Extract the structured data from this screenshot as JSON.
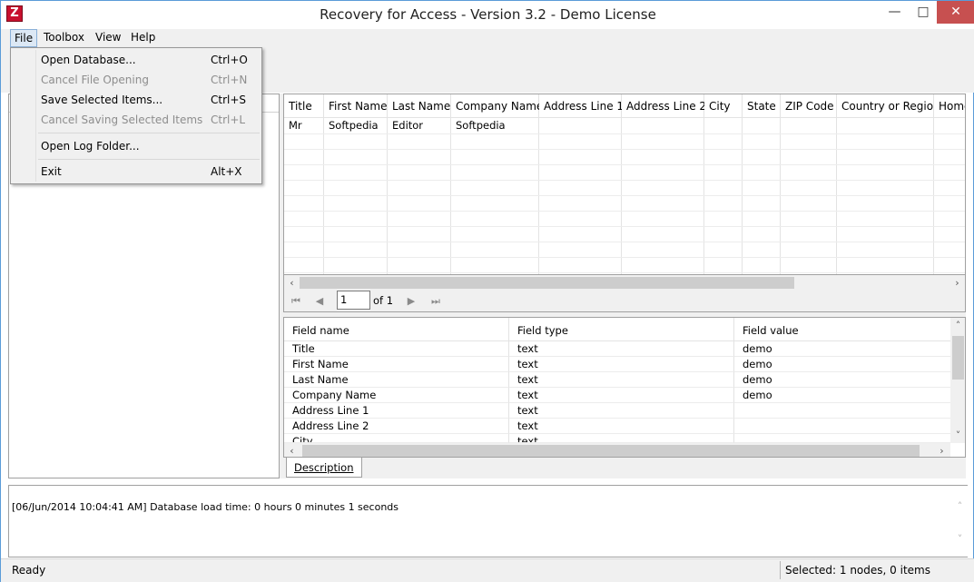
{
  "window": {
    "title": "Recovery for Access - Version 3.2 - Demo License",
    "app_icon": "Z",
    "minimize_icon": "minimize-icon",
    "maximize_icon": "maximize-icon",
    "close_icon": "close-icon",
    "min_glyph": "—",
    "max_glyph": "□",
    "close_glyph": "✕"
  },
  "menubar": {
    "file": "File",
    "toolbox": "Toolbox",
    "view": "View",
    "help": "Help"
  },
  "file_menu": {
    "items": [
      {
        "label": "Open Database...",
        "shortcut": "Ctrl+O",
        "enabled": true
      },
      {
        "label": "Cancel File Opening",
        "shortcut": "Ctrl+N",
        "enabled": false
      },
      {
        "label": "Save Selected Items...",
        "shortcut": "Ctrl+S",
        "enabled": true
      },
      {
        "label": "Cancel Saving Selected Items",
        "shortcut": "Ctrl+L",
        "enabled": false
      },
      {
        "label": "Open Log Folder...",
        "shortcut": "",
        "enabled": true
      },
      {
        "label": "Exit",
        "shortcut": "Alt+X",
        "enabled": true
      }
    ]
  },
  "grid": {
    "columns": [
      "Title",
      "First Name",
      "Last Name",
      "Company Name",
      "Address Line 1",
      "Address Line 2",
      "City",
      "State",
      "ZIP Code",
      "Country or Region",
      "Home"
    ],
    "rows": [
      [
        "Mr",
        "Softpedia",
        "Editor",
        "Softpedia",
        "",
        "",
        "",
        "",
        "",
        "",
        ""
      ]
    ]
  },
  "navigator": {
    "first_glyph": "⏮",
    "prev_glyph": "◀",
    "next_glyph": "▶",
    "last_glyph": "⏭",
    "page": "1",
    "of_label": "of 1"
  },
  "details": {
    "headers": [
      "Field name",
      "Field type",
      "Field value"
    ],
    "rows": [
      [
        "Title",
        "text",
        "demo"
      ],
      [
        "First Name",
        "text",
        "demo"
      ],
      [
        "Last Name",
        "text",
        "demo"
      ],
      [
        "Company Name",
        "text",
        "demo"
      ],
      [
        "Address Line 1",
        "text",
        ""
      ],
      [
        "Address Line 2",
        "text",
        ""
      ],
      [
        "City",
        "text",
        ""
      ]
    ]
  },
  "tabs": {
    "description": "Description"
  },
  "log": {
    "entry": "[06/Jun/2014 10:04:41 AM] Database load time: 0 hours 0 minutes 1 seconds"
  },
  "status": {
    "ready": "Ready",
    "selected": "Selected: 1 nodes, 0 items"
  },
  "scroll": {
    "left_glyph": "‹",
    "right_glyph": "›",
    "up_glyph": "˄",
    "down_glyph": "˅"
  }
}
